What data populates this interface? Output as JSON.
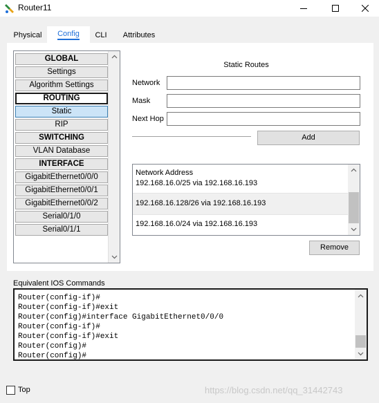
{
  "window": {
    "title": "Router11",
    "minimize_icon": "minimize-icon",
    "maximize_icon": "maximize-icon",
    "close_icon": "close-icon"
  },
  "tabs": [
    {
      "label": "Physical"
    },
    {
      "label": "Config",
      "active": true
    },
    {
      "label": "CLI"
    },
    {
      "label": "Attributes"
    }
  ],
  "sidebar": {
    "items": [
      {
        "label": "GLOBAL",
        "kind": "header"
      },
      {
        "label": "Settings"
      },
      {
        "label": "Algorithm Settings"
      },
      {
        "label": "ROUTING",
        "kind": "header"
      },
      {
        "label": "Static",
        "selected": true
      },
      {
        "label": "RIP"
      },
      {
        "label": "SWITCHING",
        "kind": "header"
      },
      {
        "label": "VLAN Database"
      },
      {
        "label": "INTERFACE",
        "kind": "header"
      },
      {
        "label": "GigabitEthernet0/0/0"
      },
      {
        "label": "GigabitEthernet0/0/1"
      },
      {
        "label": "GigabitEthernet0/0/2"
      },
      {
        "label": "Serial0/1/0"
      },
      {
        "label": "Serial0/1/1"
      }
    ]
  },
  "static_routes": {
    "title": "Static Routes",
    "network_label": "Network",
    "network_value": "",
    "mask_label": "Mask",
    "mask_value": "",
    "next_hop_label": "Next Hop",
    "next_hop_value": "",
    "add_label": "Add",
    "list_header": "Network Address",
    "routes": [
      "192.168.16.0/25 via 192.168.16.193",
      "192.168.16.128/26 via 192.168.16.193",
      "192.168.16.0/24 via 192.168.16.193"
    ],
    "remove_label": "Remove"
  },
  "ios": {
    "label": "Equivalent IOS Commands",
    "lines": [
      "Router(config-if)#",
      "Router(config-if)#exit",
      "Router(config)#interface GigabitEthernet0/0/0",
      "Router(config-if)#",
      "Router(config-if)#exit",
      "Router(config)#",
      "Router(config)#"
    ]
  },
  "footer": {
    "top_label": "Top",
    "top_checked": false,
    "watermark": "https://blog.csdn.net/qq_31442743"
  },
  "colors": {
    "accent": "#1e6fd9",
    "selection": "#cce4f7"
  }
}
